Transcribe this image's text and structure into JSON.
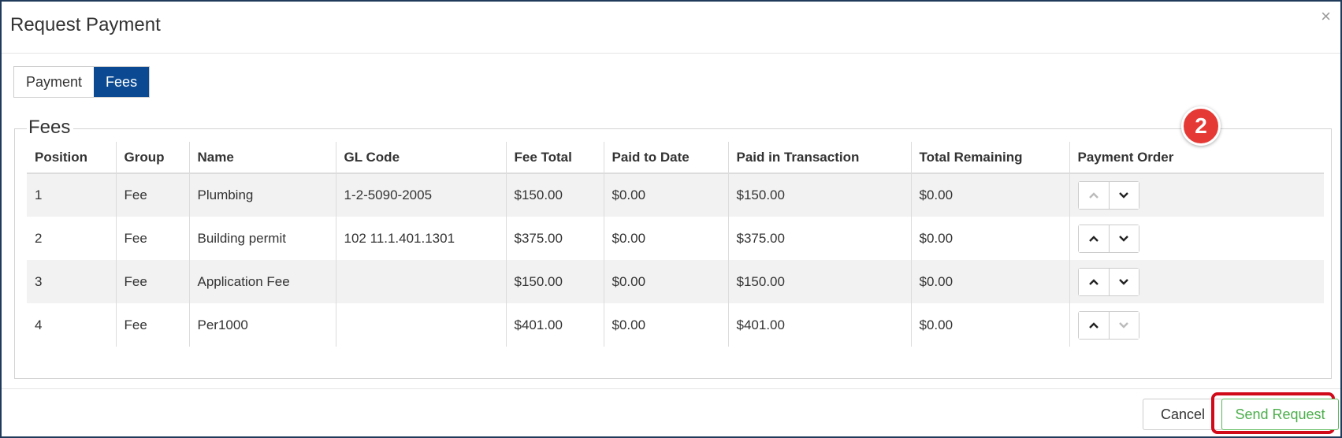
{
  "dialog": {
    "title": "Request Payment",
    "close_label": "×"
  },
  "tabs": [
    {
      "label": "Payment",
      "active": false
    },
    {
      "label": "Fees",
      "active": true
    }
  ],
  "fees_section": {
    "legend": "Fees",
    "columns": [
      "Position",
      "Group",
      "Name",
      "GL Code",
      "Fee Total",
      "Paid to Date",
      "Paid in Transaction",
      "Total Remaining",
      "Payment Order"
    ],
    "rows": [
      {
        "position": "1",
        "group": "Fee",
        "name": "Plumbing",
        "gl_code": "1-2-5090-2005",
        "fee_total": "$150.00",
        "paid_to_date": "$0.00",
        "paid_in_transaction": "$150.00",
        "total_remaining": "$0.00"
      },
      {
        "position": "2",
        "group": "Fee",
        "name": "Building permit",
        "gl_code": "102 11.1.401.1301",
        "fee_total": "$375.00",
        "paid_to_date": "$0.00",
        "paid_in_transaction": "$375.00",
        "total_remaining": "$0.00"
      },
      {
        "position": "3",
        "group": "Fee",
        "name": "Application Fee",
        "gl_code": "",
        "fee_total": "$150.00",
        "paid_to_date": "$0.00",
        "paid_in_transaction": "$150.00",
        "total_remaining": "$0.00"
      },
      {
        "position": "4",
        "group": "Fee",
        "name": "Per1000",
        "gl_code": "",
        "fee_total": "$401.00",
        "paid_to_date": "$0.00",
        "paid_in_transaction": "$401.00",
        "total_remaining": "$0.00"
      }
    ]
  },
  "step_badge": "2",
  "footer": {
    "cancel_label": "Cancel",
    "send_label": "Send Request"
  },
  "colors": {
    "tab_active_bg": "#0b4a92",
    "send_button": "#4cae4c",
    "highlight_border": "#d10a1a",
    "badge_bg": "#e53935"
  },
  "icons": {
    "move_up": "chevron-up-icon",
    "move_down": "chevron-down-icon",
    "close": "close-icon"
  }
}
